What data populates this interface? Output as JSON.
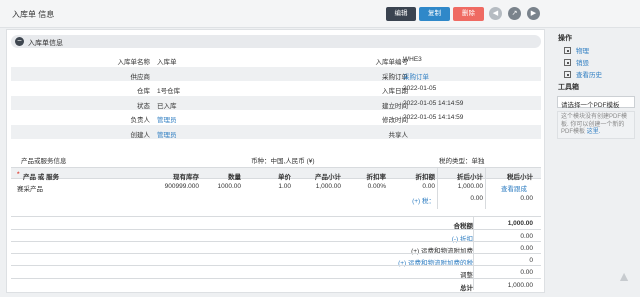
{
  "header": {
    "title": "入库单 信息",
    "edit_label": "编辑",
    "copy_label": "复制",
    "delete_label": "删除"
  },
  "section": {
    "title": "入库单信息",
    "collapse_symbol": "−"
  },
  "info": [
    {
      "l1": "入库单名称",
      "v1": "入库单",
      "l2": "入库单编号",
      "v2": "WHE3"
    },
    {
      "l1": "供应商",
      "v1": "",
      "l2": "采购订单",
      "v2": "采购订单"
    },
    {
      "l1": "仓库",
      "v1": "1号仓库",
      "l2": "入库日期",
      "v2": "2022-01-05"
    },
    {
      "l1": "状态",
      "v1": "已入库",
      "l2": "建立时间",
      "v2": "2022-01-05 14:14:59"
    },
    {
      "l1": "负责人",
      "v1": "管理员",
      "l2": "修改时间",
      "v2": "2022-01-05 14:14:59"
    },
    {
      "l1": "创建人",
      "v1": "管理员",
      "l2": "共享人",
      "v2": ""
    }
  ],
  "products": {
    "title": "产品或服务信息",
    "currency": "币种：中国,人民币 (¥)",
    "tax_type": "税的类型：单独",
    "columns": {
      "product": "产品 或 服务",
      "stock": "现有库存",
      "qty": "数量",
      "price": "单价",
      "subtotal": "产品小计",
      "discount_rate": "折扣率",
      "discount": "折扣额",
      "after_discount": "折后小计",
      "after_tax": "税后小计"
    },
    "required_mark": "*",
    "rows": [
      {
        "product": "赛采产品",
        "stock": "900999.000",
        "qty": "1000.00",
        "price": "1.00",
        "subtotal": "1,000.00",
        "discount_rate": "0.00%",
        "discount": "0.00",
        "after_discount": "1,000.00",
        "after_tax": "",
        "action": "查看跟成",
        "tax_label": "(+) 税：",
        "tax_amount": "0.00",
        "tax_total": "0.00"
      }
    ]
  },
  "totals": {
    "pre_tax_label": "合税额",
    "pre_tax": "1,000.00",
    "discount_label": "(-) 折扣",
    "discount": "0.00",
    "shipping_label": "(+) 运费和物流附加费",
    "shipping": "0.00",
    "shipping_tax_label": "(+) 运费和物流附加费的税",
    "shipping_tax": "0",
    "adjust_label": "调整",
    "adjust": "0.00",
    "total_label": "总计",
    "total": "1,000.00"
  },
  "sidebar": {
    "actions_title": "操作",
    "actions": [
      "物理",
      "销毁",
      "查看历史"
    ],
    "tools_title": "工具箱",
    "template_select": "请选择一个PDF模板",
    "template_note": "这个模块没有创建PDF模板. 你可以创建一个新的PDF模板",
    "template_note_link": "这里."
  },
  "colors": {
    "edit_btn": "#3a4350",
    "copy_btn": "#2f88c9",
    "delete_btn": "#ef6a62",
    "link": "#2f7ec2"
  }
}
